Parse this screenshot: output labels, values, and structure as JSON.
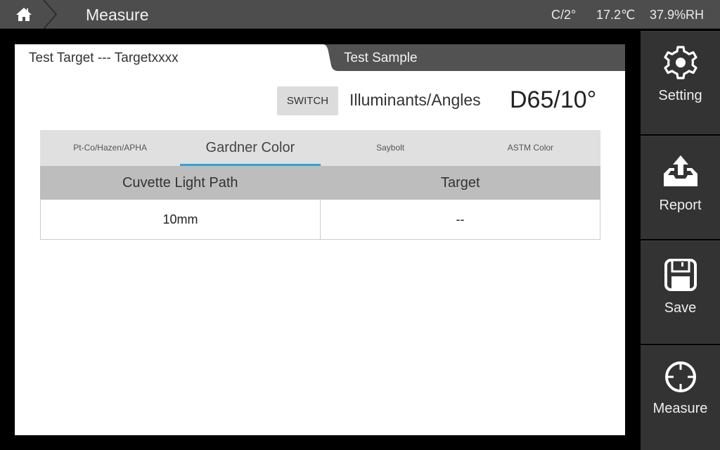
{
  "topbar": {
    "title": "Measure",
    "status": {
      "mode": "C/2°",
      "temperature": "17.2℃",
      "humidity": "37.9%RH"
    }
  },
  "panel": {
    "tabs": [
      {
        "label": "Test Target --- Targetxxxx",
        "active": true
      },
      {
        "label": "Test Sample",
        "active": false
      }
    ],
    "switch_label": "SWITCH",
    "illuminants_label": "Illuminants/Angles",
    "illuminants_value": "D65/10°",
    "method_tabs": [
      {
        "label": "Pt-Co/Hazen/APHA",
        "active": false
      },
      {
        "label": "Gardner Color",
        "active": true
      },
      {
        "label": "Saybolt",
        "active": false
      },
      {
        "label": "ASTM Color",
        "active": false
      }
    ],
    "table": {
      "headers": [
        "Cuvette Light Path",
        "Target"
      ],
      "rows": [
        [
          "10mm",
          "--"
        ]
      ]
    }
  },
  "sidebar": {
    "items": [
      {
        "label": "Setting",
        "icon": "gear-icon"
      },
      {
        "label": "Report",
        "icon": "upload-tray-icon"
      },
      {
        "label": "Save",
        "icon": "floppy-disk-icon"
      },
      {
        "label": "Measure",
        "icon": "crosshair-icon"
      }
    ]
  },
  "colors": {
    "accent": "#2fa3d8",
    "topbar": "#4d4d4d",
    "sidebar_button": "#333333",
    "table_header": "#bdbdbd",
    "method_tabs_bg": "#e0e0e0"
  }
}
